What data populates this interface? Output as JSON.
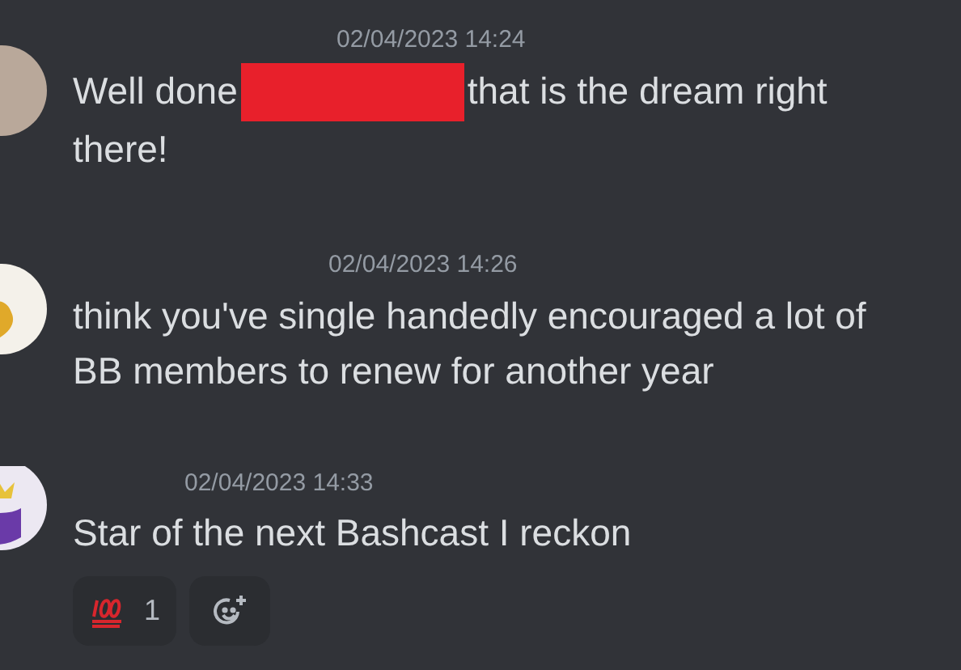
{
  "messages": [
    {
      "timestamp": "02/04/2023 14:24",
      "kind": "photo",
      "text_before": "Well done",
      "redacted": true,
      "text_after": "that is the dream right there!"
    },
    {
      "timestamp": "02/04/2023 14:26",
      "kind": "yellow",
      "text_before": "think you've single handedly encouraged a lot of BB members to renew for another year",
      "redacted": false
    },
    {
      "timestamp": "02/04/2023 14:33",
      "kind": "purple",
      "text_before": "Star of the next Bashcast I reckon",
      "redacted": false,
      "reactions": [
        {
          "count": "1"
        }
      ]
    }
  ]
}
